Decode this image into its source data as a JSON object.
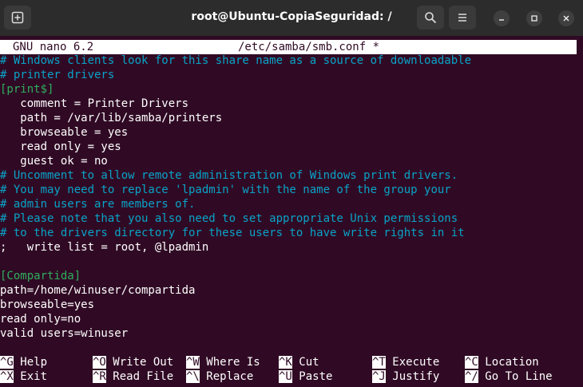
{
  "window": {
    "title": "root@Ubuntu-CopiaSeguridad: /",
    "icons": {
      "new_tab": "new-tab-icon",
      "search": "search-icon",
      "menu": "hamburger-menu-icon",
      "minimize": "minimize-icon",
      "maximize": "maximize-icon",
      "close": "close-icon"
    }
  },
  "nano": {
    "version": "GNU nano 6.2",
    "filename": "/etc/samba/smb.conf *"
  },
  "lines": [
    {
      "text": "# Windows clients look for this share name as a source of downloadable",
      "kind": "comment"
    },
    {
      "text": "# printer drivers",
      "kind": "comment"
    },
    {
      "text": "[print$]",
      "kind": "section"
    },
    {
      "text": "   comment = Printer Drivers",
      "kind": "text"
    },
    {
      "text": "   path = /var/lib/samba/printers",
      "kind": "text"
    },
    {
      "text": "   browseable = yes",
      "kind": "text"
    },
    {
      "text": "   read only = yes",
      "kind": "text"
    },
    {
      "text": "   guest ok = no",
      "kind": "text"
    },
    {
      "text": "# Uncomment to allow remote administration of Windows print drivers.",
      "kind": "comment"
    },
    {
      "text": "# You may need to replace 'lpadmin' with the name of the group your",
      "kind": "comment"
    },
    {
      "text": "# admin users are members of.",
      "kind": "comment"
    },
    {
      "text": "# Please note that you also need to set appropriate Unix permissions",
      "kind": "comment"
    },
    {
      "text": "# to the drivers directory for these users to have write rights in it",
      "kind": "comment"
    },
    {
      "text": ";   write list = root, @lpadmin",
      "kind": "text"
    },
    {
      "text": "",
      "kind": "text"
    },
    {
      "text": "[Compartida]",
      "kind": "section"
    },
    {
      "text": "path=/home/winuser/compartida",
      "kind": "text"
    },
    {
      "text": "browseable=yes",
      "kind": "text"
    },
    {
      "text": "read only=no",
      "kind": "text"
    },
    {
      "text": "valid users=winuser",
      "kind": "text"
    }
  ],
  "shortcuts": [
    {
      "key": "^G",
      "label": "Help"
    },
    {
      "key": "^O",
      "label": "Write Out"
    },
    {
      "key": "^W",
      "label": "Where Is"
    },
    {
      "key": "^K",
      "label": "Cut"
    },
    {
      "key": "^T",
      "label": "Execute"
    },
    {
      "key": "^C",
      "label": "Location"
    },
    {
      "key": "^X",
      "label": "Exit"
    },
    {
      "key": "^R",
      "label": "Read File"
    },
    {
      "key": "^\\",
      "label": "Replace"
    },
    {
      "key": "^U",
      "label": "Paste"
    },
    {
      "key": "^J",
      "label": "Justify"
    },
    {
      "key": "^/",
      "label": "Go To Line"
    }
  ],
  "colors": {
    "terminal_bg": "#300a24",
    "comment": "#0aa3c8",
    "section": "#2fae5e",
    "titlebar": "#2c2c2c"
  }
}
